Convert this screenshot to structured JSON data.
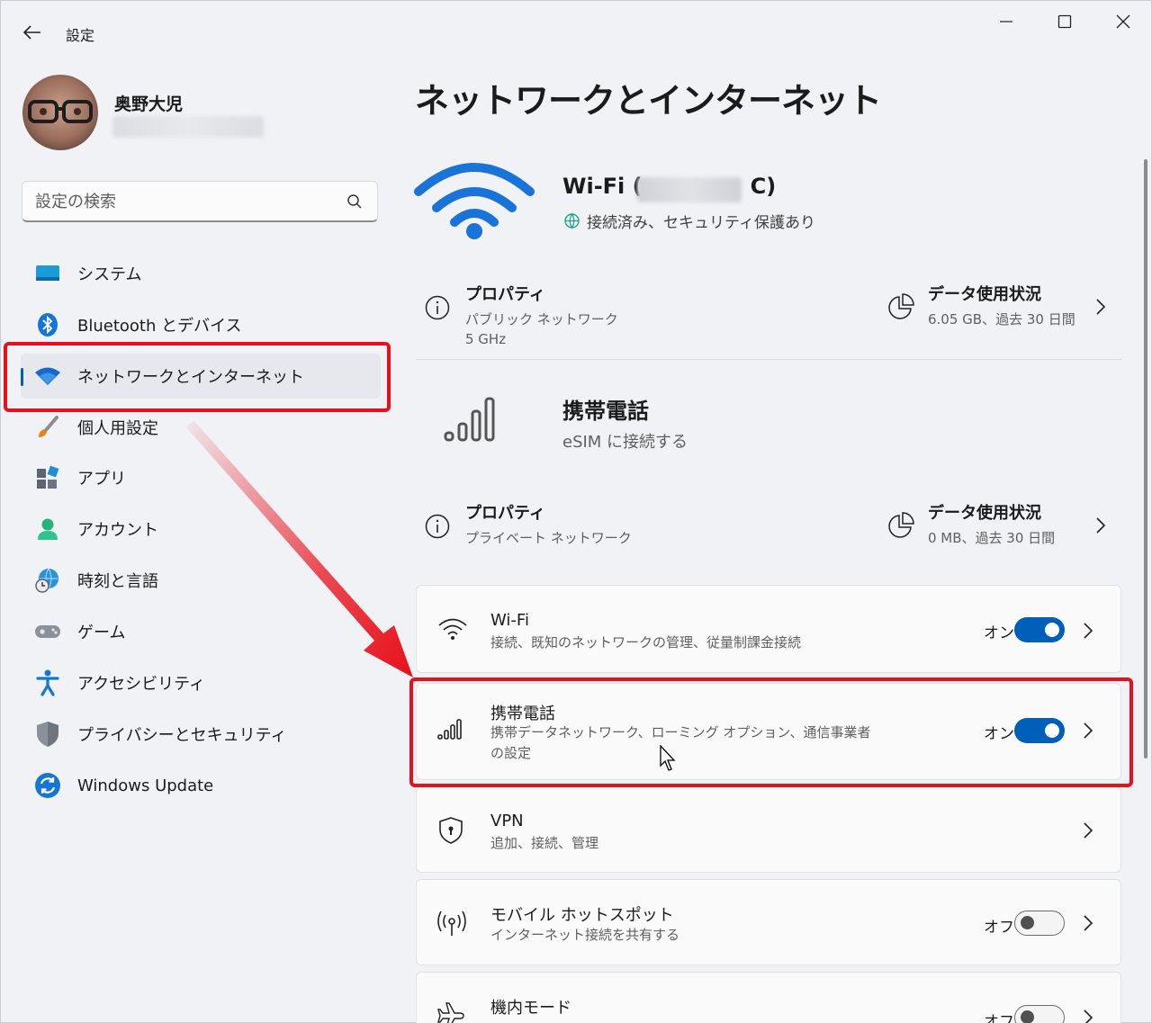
{
  "app": {
    "title": "設定"
  },
  "user": {
    "name": "奥野大児"
  },
  "search": {
    "placeholder": "設定の検索"
  },
  "sidebar": {
    "items": [
      {
        "label": "システム"
      },
      {
        "label": "Bluetooth とデバイス"
      },
      {
        "label": "ネットワークとインターネット"
      },
      {
        "label": "個人用設定"
      },
      {
        "label": "アプリ"
      },
      {
        "label": "アカウント"
      },
      {
        "label": "時刻と言語"
      },
      {
        "label": "ゲーム"
      },
      {
        "label": "アクセシビリティ"
      },
      {
        "label": "プライバシーとセキュリティ"
      },
      {
        "label": "Windows Update"
      }
    ]
  },
  "main": {
    "title": "ネットワークとインターネット",
    "wifi_header": {
      "name_prefix": "Wi-Fi (",
      "name_suffix": "C)",
      "status": "接続済み、セキュリティ保護あり"
    },
    "wifi_props": {
      "title": "プロパティ",
      "line1": "パブリック ネットワーク",
      "line2": "5 GHz",
      "usage_title": "データ使用状況",
      "usage_value": "6.05 GB、過去 30 日間"
    },
    "mobile_header": {
      "title": "携帯電話",
      "subtitle": "eSIM に接続する"
    },
    "mobile_props": {
      "title": "プロパティ",
      "line1": "プライベート ネットワーク",
      "usage_title": "データ使用状況",
      "usage_value": "0 MB、過去 30 日間"
    },
    "cards": [
      {
        "title": "Wi-Fi",
        "subtitle": "接続、既知のネットワークの管理、従量制課金接続",
        "state": "オン",
        "toggle": "on"
      },
      {
        "title": "携帯電話",
        "subtitle": "携帯データネットワーク、ローミング オプション、通信事業者",
        "subtitle2": "の設定",
        "state": "オン",
        "toggle": "on"
      },
      {
        "title": "VPN",
        "subtitle": "追加、接続、管理"
      },
      {
        "title": "モバイル ホットスポット",
        "subtitle": "インターネット接続を共有する",
        "state": "オフ",
        "toggle": "off"
      },
      {
        "title": "機内モード",
        "state": "オフ",
        "toggle": "off"
      }
    ]
  },
  "colors": {
    "accent": "#005fb8",
    "highlight": "#e8101a",
    "wifi_icon": "#1a73d9"
  }
}
